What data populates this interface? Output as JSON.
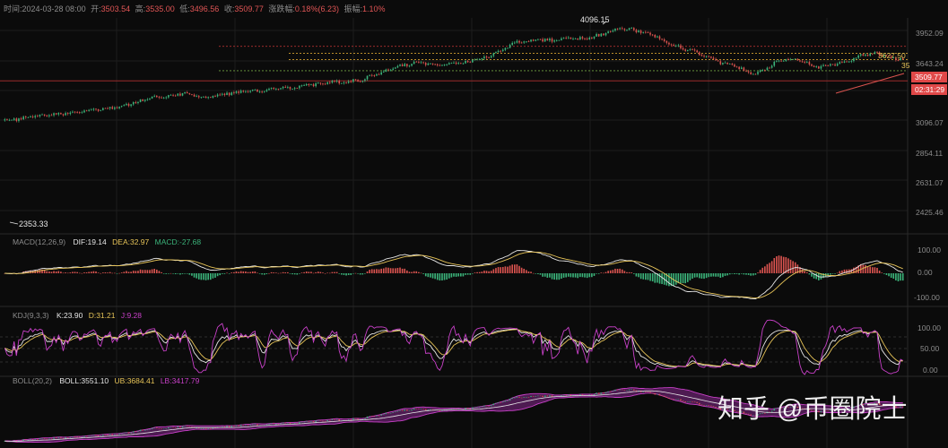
{
  "theme": {
    "bg": "#0b0b0b",
    "grid": "#1c1c1c",
    "separator": "#2a2a2a",
    "up": "#3bb37a",
    "down": "#d9534f",
    "text": "#8c8c8c",
    "label_down": "#e05555",
    "current_price_bg": "#e04848",
    "macd_dif": "#e6e6e6",
    "macd_dea": "#e7c458",
    "macd_text": "#3bb37a",
    "kdj_k": "#e6e6e6",
    "kdj_d": "#e7c458",
    "kdj_j": "#c840c8",
    "boll_mid": "#e6e6e6",
    "boll_band": "#c840c8",
    "boll_fill": "#5a1f5f",
    "level_red": "#b03030",
    "level_orange": "#d4a030",
    "level_green": "#6fa040"
  },
  "header": {
    "time_label": "时间:",
    "time": "2024-03-28 08:00",
    "open_label": "开:",
    "open": "3503.54",
    "high_label": "高:",
    "high": "3535.00",
    "low_label": "低:",
    "low": "3496.56",
    "close_label": "收:",
    "close": "3509.77",
    "change_label": "涨跌幅:",
    "change": "0.18%(6.23)",
    "amplitude_label": "振幅:",
    "amplitude": "1.10%"
  },
  "main_panel": {
    "y_ticks": [
      "3952.09",
      "3643.24",
      "3096.07",
      "2854.11",
      "2631.07",
      "2425.46"
    ],
    "price_label": "3509.77",
    "countdown_label": "02:31:29",
    "high_annotation": "4096.15",
    "low_annotation": "2353.33",
    "level_annotation": "3627.50",
    "level_annotation_cut": "35"
  },
  "macd": {
    "name": "MACD(12,26,9)",
    "dif_label": "DIF:19.14",
    "dea_label": "DEA:32.97",
    "macd_label": "MACD:-27.68",
    "y_ticks": [
      "100.00",
      "0.00",
      "-100.00"
    ]
  },
  "kdj": {
    "name": "KDJ(9,3,3)",
    "k_label": "K:23.90",
    "d_label": "D:31.21",
    "j_label": "J:9.28",
    "y_ticks": [
      "100.00",
      "50.00",
      "0.00"
    ]
  },
  "boll": {
    "name": "BOLL(20,2)",
    "boll_label": "BOLL:3551.10",
    "ub_label": "UB:3684.41",
    "lb_label": "LB:3417.79"
  },
  "watermark": {
    "text": "知乎 @币圈院士"
  },
  "chart_data": {
    "type": "candlestick",
    "instrument_timeframe": "",
    "anchors": [
      [
        0,
        2353.33
      ],
      [
        10,
        2420
      ],
      [
        20,
        2470
      ],
      [
        30,
        2520
      ],
      [
        38,
        2560
      ],
      [
        46,
        2610
      ],
      [
        54,
        2680
      ],
      [
        62,
        2780
      ],
      [
        70,
        2840
      ],
      [
        78,
        2870
      ],
      [
        86,
        2800
      ],
      [
        94,
        2860
      ],
      [
        102,
        2900
      ],
      [
        110,
        2920
      ],
      [
        118,
        2960
      ],
      [
        126,
        3000
      ],
      [
        134,
        3060
      ],
      [
        140,
        3090
      ],
      [
        146,
        3080
      ],
      [
        154,
        3150
      ],
      [
        162,
        3280
      ],
      [
        170,
        3400
      ],
      [
        176,
        3460
      ],
      [
        182,
        3420
      ],
      [
        190,
        3430
      ],
      [
        198,
        3470
      ],
      [
        206,
        3560
      ],
      [
        212,
        3680
      ],
      [
        216,
        3790
      ],
      [
        220,
        3840
      ],
      [
        228,
        3890
      ],
      [
        234,
        3870
      ],
      [
        240,
        3920
      ],
      [
        248,
        3900
      ],
      [
        254,
        3960
      ],
      [
        258,
        4040
      ],
      [
        262,
        4096.15
      ],
      [
        270,
        4060
      ],
      [
        276,
        4000
      ],
      [
        282,
        3860
      ],
      [
        288,
        3760
      ],
      [
        294,
        3660
      ],
      [
        300,
        3560
      ],
      [
        306,
        3460
      ],
      [
        312,
        3380
      ],
      [
        318,
        3270
      ],
      [
        321,
        3230
      ],
      [
        324,
        3300
      ],
      [
        330,
        3480
      ],
      [
        336,
        3530
      ],
      [
        342,
        3460
      ],
      [
        348,
        3360
      ],
      [
        354,
        3420
      ],
      [
        360,
        3480
      ],
      [
        366,
        3590
      ],
      [
        372,
        3620
      ],
      [
        376,
        3600
      ],
      [
        380,
        3540
      ],
      [
        384,
        3509.77
      ]
    ],
    "levels": [
      {
        "value": 3760,
        "style": "red-dotted"
      },
      {
        "value": 3627.5,
        "style": "orange-dotted"
      },
      {
        "value": 3509.77,
        "style": "orange-dotted"
      },
      {
        "value": 3300,
        "style": "green-dotted"
      },
      {
        "value": 3110,
        "style": "red-solid"
      }
    ],
    "y_axis_ticks": [
      3952.09,
      3643.24,
      3096.07,
      2854.11,
      2631.07,
      2425.46
    ],
    "last_close": 3509.77,
    "macd_last": {
      "dif": 19.14,
      "dea": 32.97,
      "macd": -27.68
    },
    "kdj_last": {
      "k": 23.9,
      "d": 31.21,
      "j": 9.28
    },
    "boll_last": {
      "mid": 3551.1,
      "ub": 3684.41,
      "lb": 3417.79
    }
  }
}
